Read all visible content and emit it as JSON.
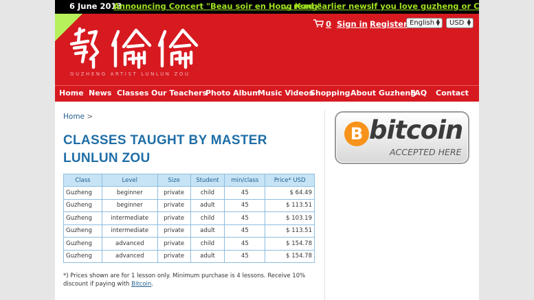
{
  "ticker": {
    "date": "6 June 2013",
    "announcement": "Announcing Concert \"Beau soir en Hong Kong\"",
    "read_more": "... read earlier news",
    "promo": "If you love guzheng or Chinese m"
  },
  "header": {
    "cart_count": "0",
    "sign_in": "Sign in",
    "register": "Register",
    "language": "English",
    "currency": "USD",
    "logo_subtitle": "GUZHENG ARTIST LUNLUN ZOU",
    "brand_color": "#d71920",
    "accent_color": "#9fe01f"
  },
  "nav": {
    "items": [
      {
        "label": "Home"
      },
      {
        "label": "News"
      },
      {
        "label": "Classes"
      },
      {
        "label": "Our Teachers"
      },
      {
        "label": "Photo Album"
      },
      {
        "label": "Music Videos"
      },
      {
        "label": "Shopping"
      },
      {
        "label": "About Guzheng"
      },
      {
        "label": "FAQ"
      },
      {
        "label": "Contact"
      }
    ]
  },
  "main": {
    "breadcrumb": "Home",
    "breadcrumb_sep": ">",
    "title": "CLASSES TAUGHT BY MASTER LUNLUN ZOU",
    "table": {
      "headers": [
        "Class",
        "Level",
        "Size",
        "Student",
        "min/class",
        "Price* USD"
      ],
      "rows": [
        [
          "Guzheng",
          "beginner",
          "private",
          "child",
          "45",
          "$ 64.49"
        ],
        [
          "Guzheng",
          "beginner",
          "private",
          "adult",
          "45",
          "$ 113.51"
        ],
        [
          "Guzheng",
          "intermediate",
          "private",
          "child",
          "45",
          "$ 103.19"
        ],
        [
          "Guzheng",
          "intermediate",
          "private",
          "adult",
          "45",
          "$ 113.51"
        ],
        [
          "Guzheng",
          "advanced",
          "private",
          "child",
          "45",
          "$ 154.78"
        ],
        [
          "Guzheng",
          "advanced",
          "private",
          "adult",
          "45",
          "$ 154.78"
        ]
      ]
    },
    "note_text": "*) Prices shown are for 1 lesson only. Minimum purchase is 4 lessons. Receive 10% discount if paying with ",
    "note_link": "Bitcoin",
    "note_end": "."
  },
  "sidebar": {
    "badge_symbol": "B",
    "badge_word": "bitcoin",
    "badge_subtitle": "ACCEPTED HERE",
    "bitcoin_color": "#f7931a"
  }
}
